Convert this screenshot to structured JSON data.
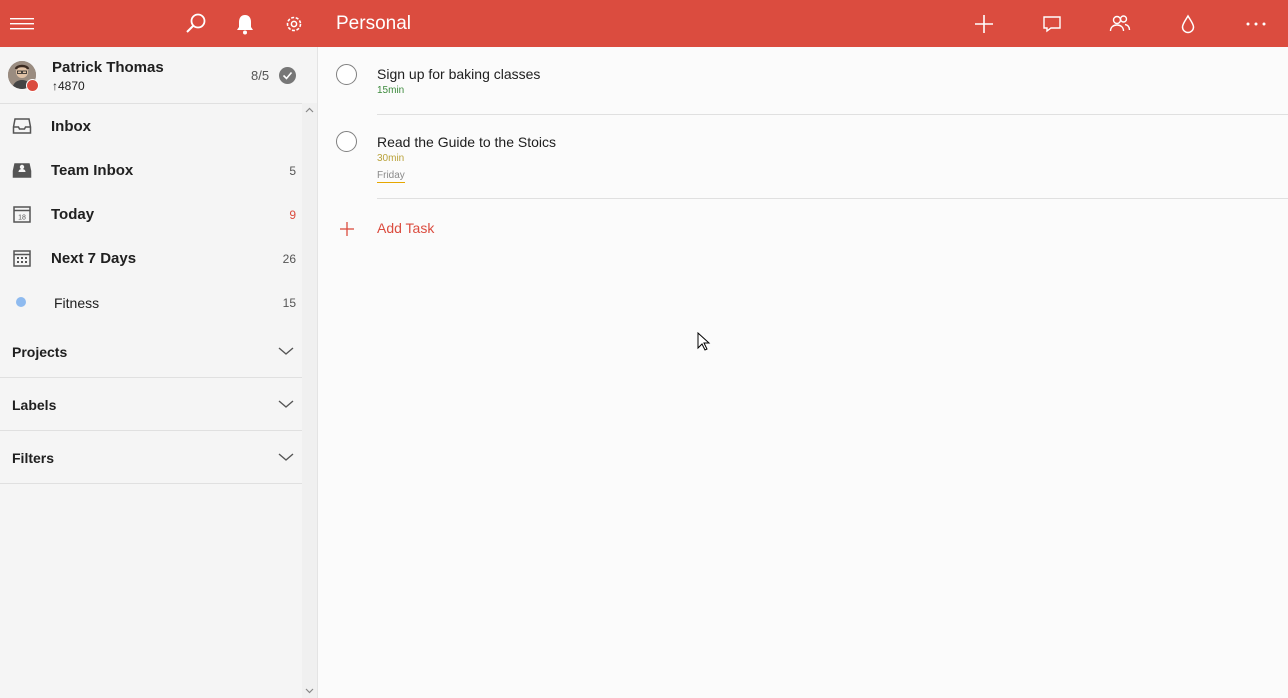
{
  "app": {
    "title": "Personal",
    "brand_color": "#db4c3f"
  },
  "toolbar": {
    "left_icons": [
      "menu-icon",
      "search-icon",
      "bell-icon",
      "gear-icon"
    ],
    "right_icons": [
      "add-icon",
      "comment-icon",
      "share-icon",
      "theme-drop-icon",
      "more-icon"
    ]
  },
  "user": {
    "name": "Patrick Thomas",
    "karma": "↑4870",
    "goal": "8/5"
  },
  "sidebar": {
    "items": [
      {
        "label": "Inbox",
        "count": "",
        "icon": "inbox-icon"
      },
      {
        "label": "Team Inbox",
        "count": "5",
        "icon": "team-inbox-icon"
      },
      {
        "label": "Today",
        "count": "9",
        "icon": "calendar-today-icon",
        "day": "18"
      },
      {
        "label": "Next 7 Days",
        "count": "26",
        "icon": "calendar-week-icon"
      }
    ],
    "fitness": {
      "label": "Fitness",
      "count": "15",
      "color": "#8ebaef"
    },
    "sections": [
      {
        "label": "Projects"
      },
      {
        "label": "Labels"
      },
      {
        "label": "Filters"
      }
    ]
  },
  "tasks": [
    {
      "title": "Sign up for baking classes",
      "duration": "15min",
      "duration_color": "#3c8a3c",
      "date": ""
    },
    {
      "title": "Read the Guide to the Stoics",
      "duration": "30min",
      "duration_color": "#b9a23a",
      "date": "Friday"
    }
  ],
  "add_task_label": "Add Task"
}
